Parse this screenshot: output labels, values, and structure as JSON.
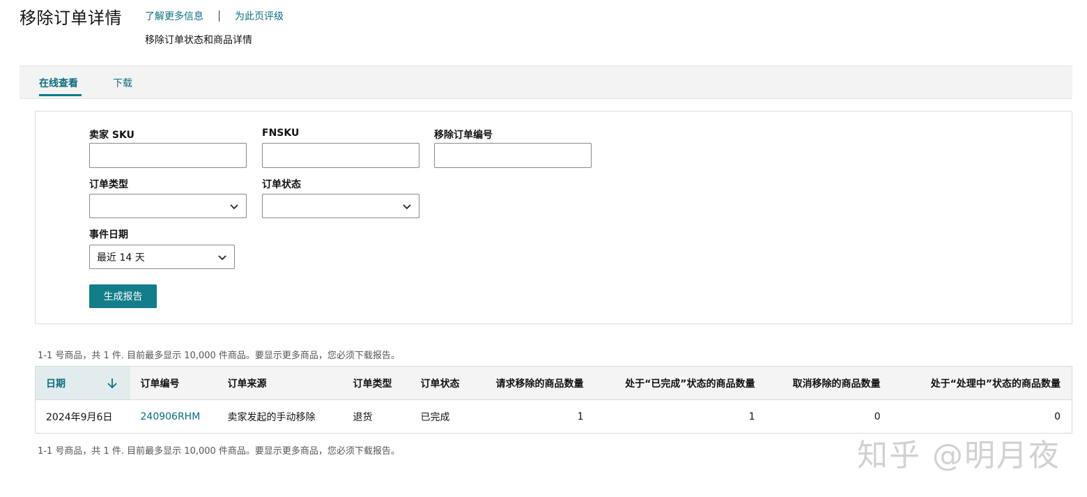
{
  "header": {
    "title": "移除订单详情",
    "learn_more": "了解更多信息",
    "rate_page": "为此页评级",
    "subtitle": "移除订单状态和商品详情"
  },
  "tabs": [
    {
      "label": "在线查看",
      "active": true
    },
    {
      "label": "下载",
      "active": false
    }
  ],
  "filters": {
    "seller_sku_label": "卖家 SKU",
    "seller_sku_value": "",
    "fnsku_label": "FNSKU",
    "fnsku_value": "",
    "removal_order_id_label": "移除订单编号",
    "removal_order_id_value": "",
    "order_type_label": "订单类型",
    "order_type_value": "",
    "order_status_label": "订单状态",
    "order_status_value": "",
    "event_date_label": "事件日期",
    "event_date_value": "最近 14 天",
    "generate_button": "生成报告"
  },
  "summary_text": "1-1 号商品，共 1 件. 目前最多显示 10,000 件商品。要显示更多商品，您必须下载报告。",
  "table": {
    "columns": [
      "日期",
      "订单编号",
      "订单来源",
      "订单类型",
      "订单状态",
      "请求移除的商品数量",
      "处于“已完成”状态的商品数量",
      "取消移除的商品数量",
      "处于“处理中”状态的商品数量"
    ],
    "sorted_column": "日期",
    "sort_direction": "descending",
    "rows": [
      {
        "date": "2024年9月6日",
        "order_id": "240906RHM",
        "order_source": "卖家发起的手动移除",
        "order_type": "退货",
        "order_status": "已完成",
        "requested_qty": "1",
        "completed_qty": "1",
        "cancelled_qty": "0",
        "in_process_qty": "0"
      }
    ]
  },
  "watermark": "知乎 @明月夜",
  "colors": {
    "accent": "#0a6e80",
    "button": "#137d8a",
    "sorted_header_bg": "#e2eced"
  }
}
